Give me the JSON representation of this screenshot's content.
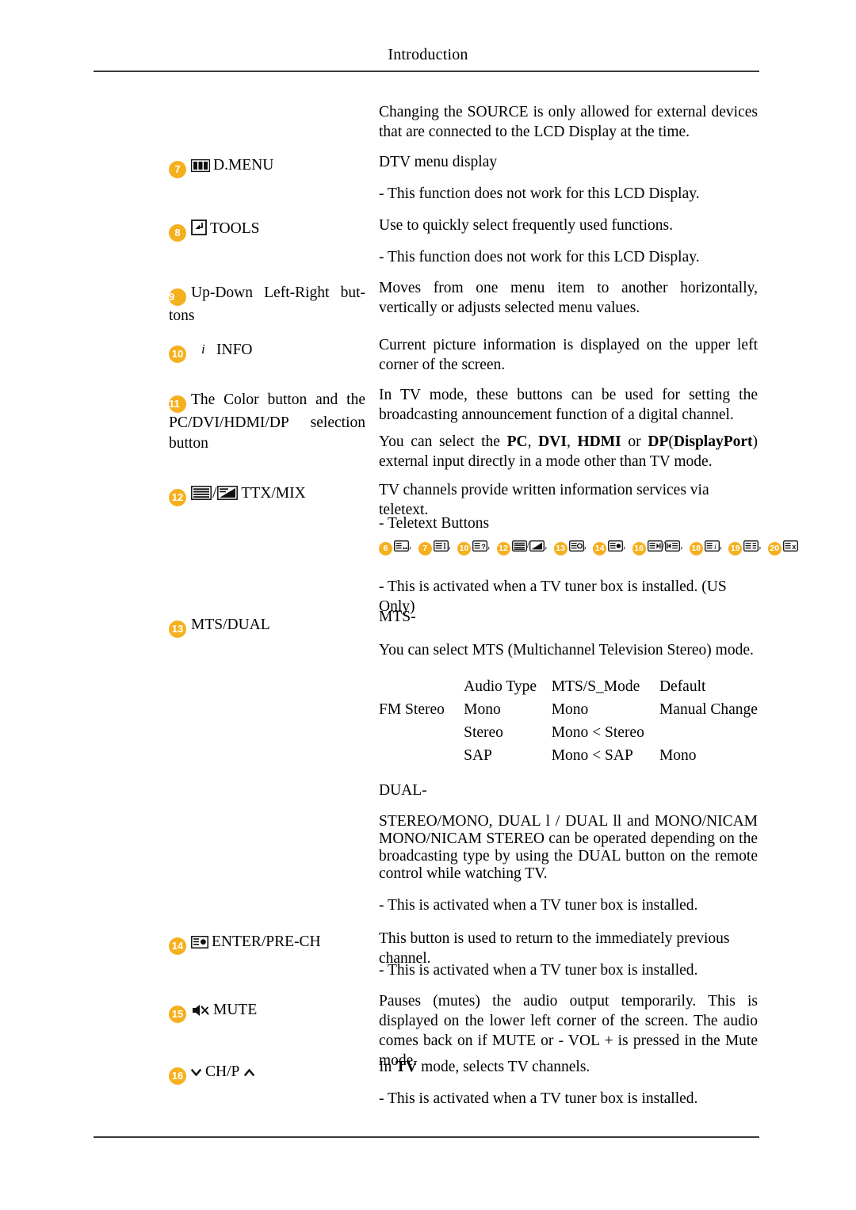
{
  "header": {
    "title": "Introduction"
  },
  "intro_paragraph": "Changing the SOURCE is only allowed for external devices that are connected to the LCD Display at the time.",
  "rows": [
    {
      "number": "7",
      "icon": "d-menu-icon",
      "label": "D.MENU",
      "desc1": "DTV menu display",
      "desc2": "- This function does not work for this LCD Display."
    },
    {
      "number": "8",
      "icon": "tools-icon",
      "label": "TOOLS",
      "desc1": "Use to quickly select frequently used functions.",
      "desc2": "- This function does not work for this LCD Display."
    },
    {
      "number": "9",
      "icon": "",
      "label": "Up-Down Left-Right but-tons",
      "desc1": "Moves from one menu item to another horizontally, vertically or adjusts selected menu values."
    },
    {
      "number": "10",
      "icon": "info-icon",
      "label": "INFO",
      "desc1": "Current picture information is displayed on the upper left corner of the screen."
    },
    {
      "number": "11",
      "icon": "",
      "label": "The Color button and the PC/DVI/HDMI/DP selection button",
      "desc1": "In TV mode, these buttons can be used for setting the broadcasting announcement function of a digital channel.",
      "desc2_prefix": "You can select the ",
      "desc2_kw1": "PC",
      "desc2_kw2": "DVI",
      "desc2_kw3": "HDMI",
      "desc2_kw4": "DP",
      "desc2_kw5": "DisplayPort",
      "desc2_suffix": ") external input directly in a mode other than TV mode."
    },
    {
      "number": "12",
      "icon": "ttx-mix-icon",
      "label": "TTX/MIX",
      "desc1": "TV channels provide written information services via teletext.",
      "desc2": "- Teletext Buttons"
    },
    {
      "number": "13",
      "icon": "",
      "label": "MTS/DUAL",
      "desc_above": "- This is activated when a TV tuner box is installed. (US Only)",
      "mts_heading": "MTS-",
      "mts_desc": "You can select MTS (Multichannel Television Stereo) mode.",
      "dual_heading": "DUAL-",
      "dual_desc": "STEREO/MONO, DUAL l / DUAL ll and MONO/NICAM MONO/NICAM STEREO can be operated depending on the broadcasting type by using the DUAL button on the remote control while watching TV.",
      "dual_note": "- This is activated when a TV tuner box is installed."
    },
    {
      "number": "14",
      "icon": "enter-prech-icon",
      "label": "ENTER/PRE-CH",
      "desc1": "This button is used to return to the immediately previous channel.",
      "desc2": "- This is activated when a TV tuner box is installed."
    },
    {
      "number": "15",
      "icon": "mute-icon",
      "label": "MUTE",
      "desc1": "Pauses (mutes) the audio output temporarily. This is displayed on the lower left corner of the screen. The audio comes back on if MUTE or - VOL + is pressed in the Mute mode."
    },
    {
      "number": "16",
      "icon": "ch-p-icon",
      "label": "CH/P",
      "desc1_prefix": "In ",
      "desc1_kw": "TV",
      "desc1_suffix": " mode, selects TV channels.",
      "desc2": "- This is activated when a TV tuner box is installed."
    }
  ],
  "teletext_buttons": {
    "label": "- Teletext Buttons",
    "items": [
      {
        "number": "6",
        "icon": "teletext-index-icon"
      },
      {
        "number": "7",
        "icon": "teletext-size-icon"
      },
      {
        "number": "10",
        "icon": "teletext-reveal-icon"
      },
      {
        "number": "12",
        "icon": "teletext-mix-icon"
      },
      {
        "number": "13",
        "icon": "teletext-hold-icon"
      },
      {
        "number": "14",
        "icon": "teletext-subpage-icon"
      },
      {
        "number": "16",
        "icon": "teletext-page-updown-icon"
      },
      {
        "number": "18",
        "icon": "teletext-info-icon"
      },
      {
        "number": "19",
        "icon": "teletext-store-icon"
      },
      {
        "number": "20",
        "icon": "teletext-cancel-icon"
      }
    ]
  },
  "mts_table": {
    "headers": [
      "",
      "Audio Type",
      "MTS/S_Mode",
      "Default"
    ],
    "rows": [
      [
        "FM Stereo",
        "Mono",
        "Mono",
        "Manual Change"
      ],
      [
        "",
        "Stereo",
        "Mono  < Stereo",
        ""
      ],
      [
        "",
        "SAP",
        "Mono  < SAP",
        "Mono"
      ]
    ]
  }
}
